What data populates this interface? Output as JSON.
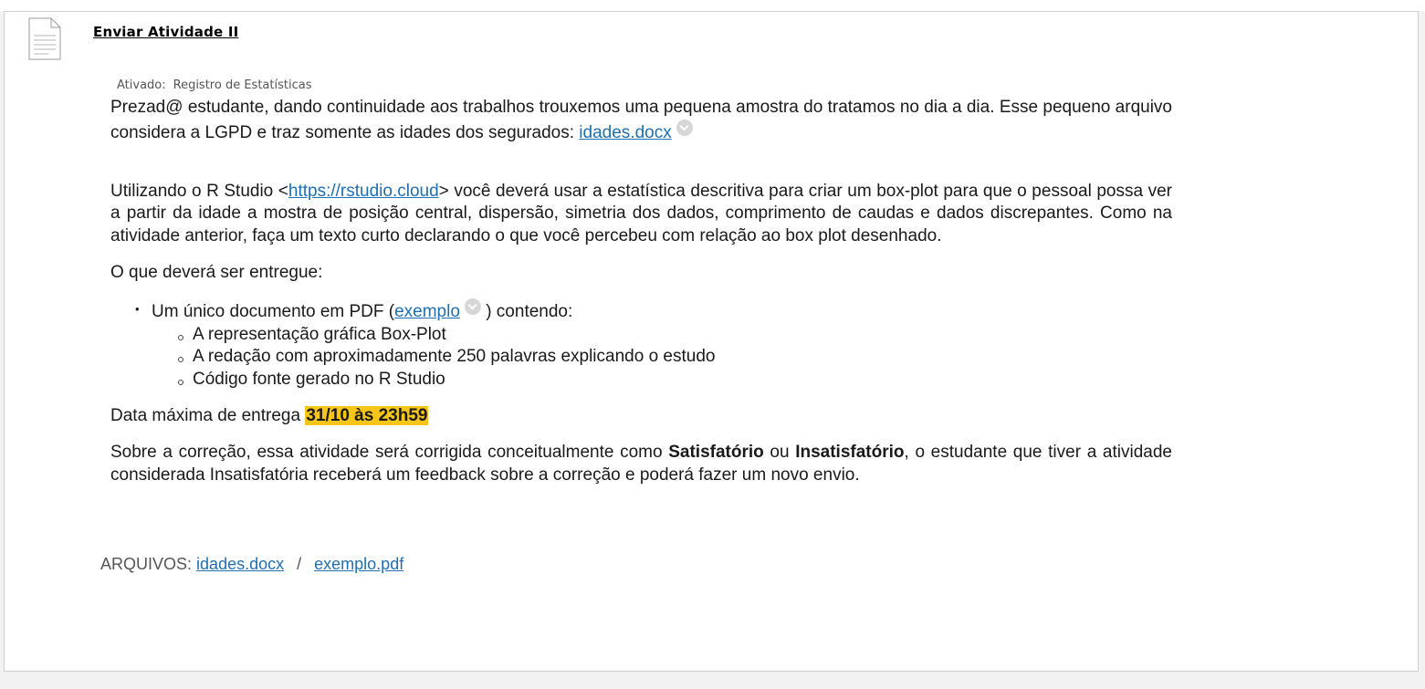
{
  "item": {
    "title": "Enviar Atividade II",
    "status_label": "Ativado:",
    "status_value": "Registro de Estatísticas"
  },
  "content": {
    "p1_text": "Prezad@ estudante, dando continuidade aos trabalhos trouxemos uma pequena amostra do tratamos no dia a dia. Esse pequeno arquivo considera a LGPD e traz somente as idades dos segurados: ",
    "p1_link": "idades.docx",
    "p2_before": "Utilizando o R Studio <",
    "p2_link": "https://rstudio.cloud",
    "p2_after": "> você deverá usar a estatística descritiva para criar um box-plot para que o pessoal possa ver a partir da idade a mostra de posição central, dispersão, simetria dos dados, comprimento de caudas e dados discrepantes. Como na atividade anterior, faça um texto curto declarando o que você percebeu com relação ao box plot desenhado.",
    "p3": "O que deverá ser entregue:",
    "bullet_before": "Um único documento em PDF (",
    "bullet_link": "exemplo",
    "bullet_after": " ) contendo:",
    "sub_items": [
      "A representação gráfica Box-Plot",
      "A redação com aproximadamente 250 palavras explicando o estudo",
      "Código fonte gerado no R Studio"
    ],
    "p4_before": "Data máxima de entrega ",
    "p4_highlight": "31/10 às 23h59",
    "p5_before": "Sobre a correção, essa atividade será corrigida conceitualmente como ",
    "p5_bold1": "Satisfatório",
    "p5_mid": " ou ",
    "p5_bold2": "Insatisfatório",
    "p5_after": ", o estudante que tiver a atividade considerada Insatisfatória receberá um feedback sobre a correção e poderá fazer um novo envio."
  },
  "files": {
    "label": "ARQUIVOS:",
    "file1": "idades.docx",
    "separator": "/",
    "file2": "exemplo.pdf"
  },
  "colors": {
    "link": "#1f6fb2",
    "highlight": "#f5c518"
  }
}
